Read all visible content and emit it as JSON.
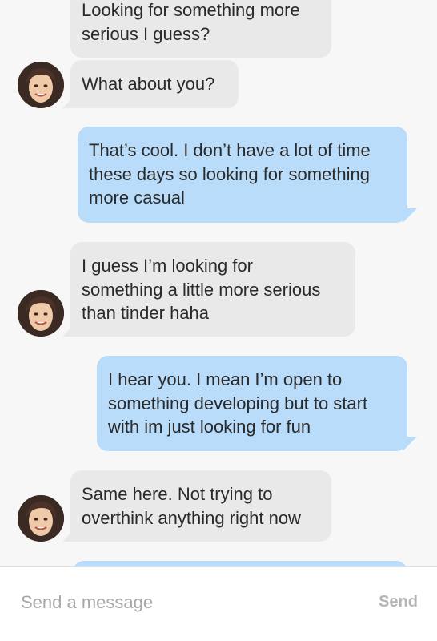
{
  "conversation": {
    "messages": [
      {
        "direction": "incoming",
        "text": "Looking for something more\nserious I guess?"
      },
      {
        "direction": "incoming",
        "text": "What about you?"
      },
      {
        "direction": "outgoing",
        "text": "That’s cool. I don’t have a lot of time\nthese days so looking for something\nmore casual"
      },
      {
        "direction": "incoming",
        "text": "I guess I’m looking for\nsomething a little more serious\nthan tinder haha"
      },
      {
        "direction": "outgoing",
        "text": "I hear you. I mean I’m open to\nsomething developing but to start\nwith im just looking for fun"
      },
      {
        "direction": "incoming",
        "text": "Same here. Not trying to\noverthink anything right now"
      },
      {
        "direction": "outgoing",
        "text": ""
      }
    ]
  },
  "composer": {
    "placeholder": "Send a message",
    "value": "",
    "send_label": "Send"
  },
  "colors": {
    "incoming_bubble": "#e9e9e9",
    "outgoing_bubble": "#b8dcf9",
    "background": "#f7f7f7"
  }
}
